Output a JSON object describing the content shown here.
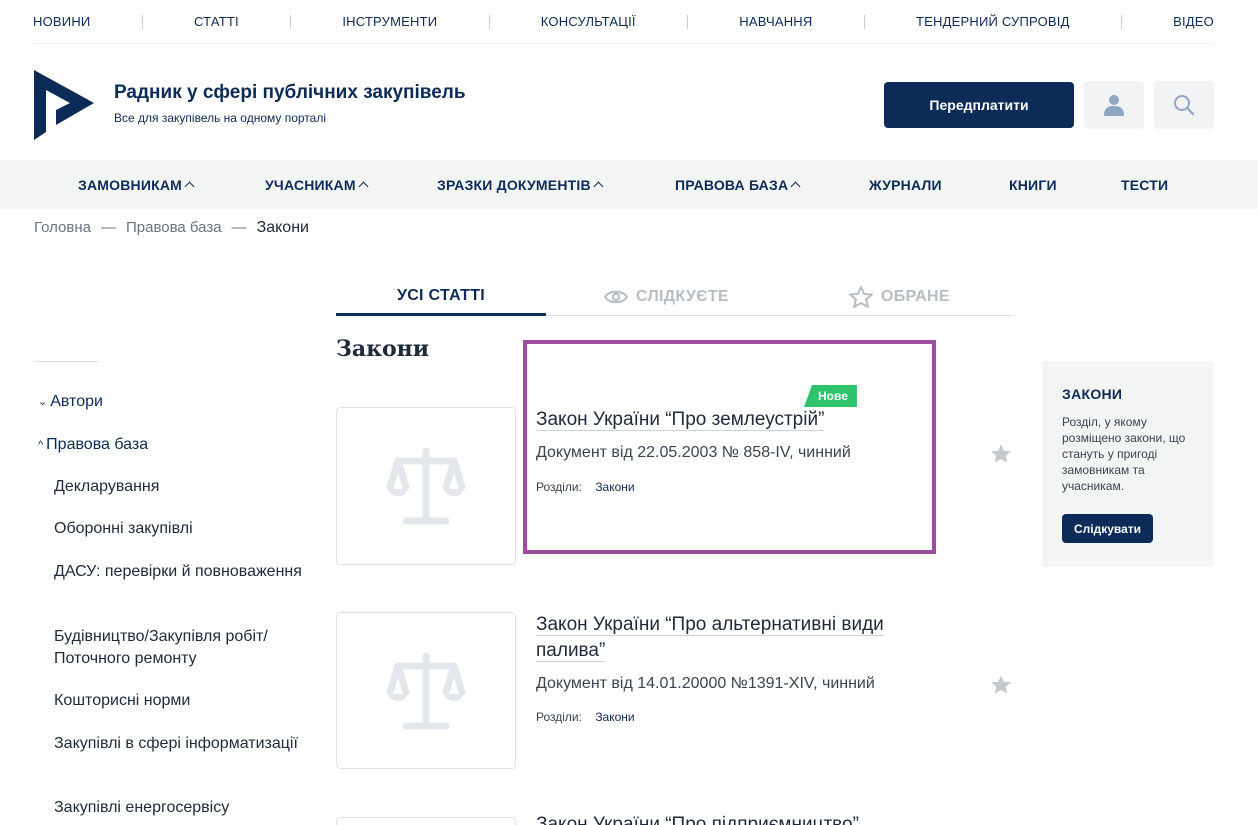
{
  "top_nav": [
    "НОВИНИ",
    "СТАТТІ",
    "ІНСТРУМЕНТИ",
    "КОНСУЛЬТАЦІЇ",
    "НАВЧАННЯ",
    "ТЕНДЕРНИЙ СУПРОВІД",
    "ВІДЕО"
  ],
  "header": {
    "title": "Радник у сфері публічних закупівель",
    "subtitle": "Все для закупівель на одному порталі",
    "subscribe_label": "Передплатити"
  },
  "main_menu": [
    {
      "label": "ЗАМОВНИКАМ",
      "has_dropdown": true
    },
    {
      "label": "УЧАСНИКАМ",
      "has_dropdown": true
    },
    {
      "label": "ЗРАЗКИ ДОКУМЕНТІВ",
      "has_dropdown": true
    },
    {
      "label": "ПРАВОВА БАЗА",
      "has_dropdown": true
    },
    {
      "label": "ЖУРНАЛИ",
      "has_dropdown": false
    },
    {
      "label": "КНИГИ",
      "has_dropdown": false
    },
    {
      "label": "ТЕСТИ",
      "has_dropdown": false
    }
  ],
  "breadcrumb": {
    "home": "Головна",
    "sep": "—",
    "section": "Правова база",
    "current": "Закони"
  },
  "tabs": {
    "all": "УСІ СТАТТІ",
    "following": "СЛІДКУЄТЕ",
    "favorites": "ОБРАНЕ"
  },
  "sidebar": {
    "groups": [
      {
        "label": "Автори",
        "expanded": false
      },
      {
        "label": "Правова база",
        "expanded": true
      }
    ],
    "items": [
      "Декларування",
      "Оборонні закупівлі",
      "ДАСУ: перевірки й повноваження",
      "Будівництво/Закупівля робіт/ Поточного ремонту",
      "Кошторисні норми",
      "Закупівлі в сфері інформатизації",
      "Закупівлі енергосервісу"
    ]
  },
  "section_title": "Закони",
  "articles": [
    {
      "badge": "Нове",
      "title": "Закон України “Про землеустрій”",
      "description": "Документ від 22.05.2003 № 858-IV, чинний",
      "sections_label": "Розділи:",
      "section": "Закони"
    },
    {
      "title": "Закон України “Про альтернативні види палива”",
      "description": "Документ від 14.01.20000 №1391-XIV, чинний",
      "sections_label": "Розділи:",
      "section": "Закони"
    },
    {
      "title": "Закон України “Про підприємництво”"
    }
  ],
  "widget": {
    "title": "ЗАКОНИ",
    "text": "Розділ, у якому розміщено закони, що стануть у пригоді замовникам та учасникам.",
    "button": "Слідкувати"
  },
  "colors": {
    "primary": "#0d2b57",
    "badge": "#2ec26a",
    "highlight": "#9b4f9f",
    "muted": "#b8bdc4"
  }
}
